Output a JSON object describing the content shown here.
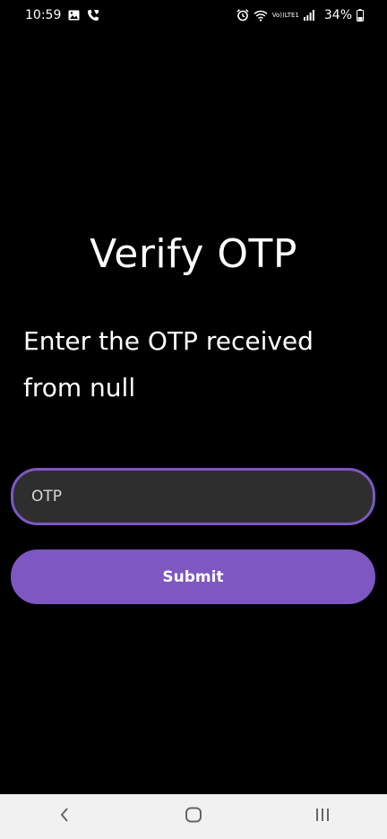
{
  "status_bar": {
    "time": "10:59",
    "battery_percent": "34%",
    "volte_line1": "Vo))",
    "volte_line2": "LTE1",
    "icons": [
      "gallery-icon",
      "call-icon",
      "alarm-icon",
      "wifi-icon",
      "volte-icon",
      "signal-icon",
      "battery-icon"
    ]
  },
  "screen": {
    "title": "Verify OTP",
    "subtitle": "Enter the OTP received from null",
    "otp_input": {
      "placeholder": "OTP",
      "value": ""
    },
    "submit_label": "Submit"
  },
  "nav_bar": {
    "buttons": [
      "back-icon",
      "home-icon",
      "recents-icon"
    ]
  },
  "colors": {
    "background": "#000000",
    "accent": "#7e57c2",
    "input_background": "#2e2e2e",
    "nav_background": "#f1f1f1"
  }
}
